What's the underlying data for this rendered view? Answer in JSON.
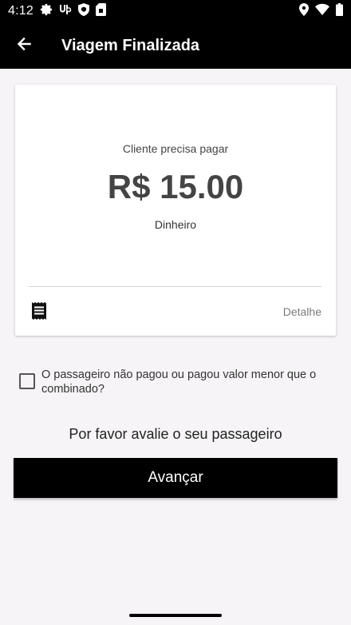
{
  "status_bar": {
    "time": "4:12",
    "left_icons": [
      "gear-icon",
      "uber-eats-icon",
      "shield-icon",
      "sim-card-icon"
    ],
    "right_icons": [
      "location-icon",
      "wifi-icon",
      "battery-icon"
    ]
  },
  "app_bar": {
    "back_icon": "arrow-left-icon",
    "title": "Viagem Finalizada"
  },
  "payment_card": {
    "label": "Cliente precisa pagar",
    "amount": "R$ 15.00",
    "method": "Dinheiro",
    "receipt_icon": "receipt-icon",
    "detail_label": "Detalhe"
  },
  "unpaid_checkbox": {
    "checked": false,
    "label": "O passageiro não pagou ou pagou valor menor que o combinado?"
  },
  "rating_prompt": "Por favor avalie o seu passageiro",
  "next_button_label": "Avançar",
  "colors": {
    "bar_background": "#000000",
    "page_background": "#f6f4f6",
    "card_background": "#ffffff",
    "amount_text": "#444444",
    "detail_text": "#7a7a7a"
  }
}
